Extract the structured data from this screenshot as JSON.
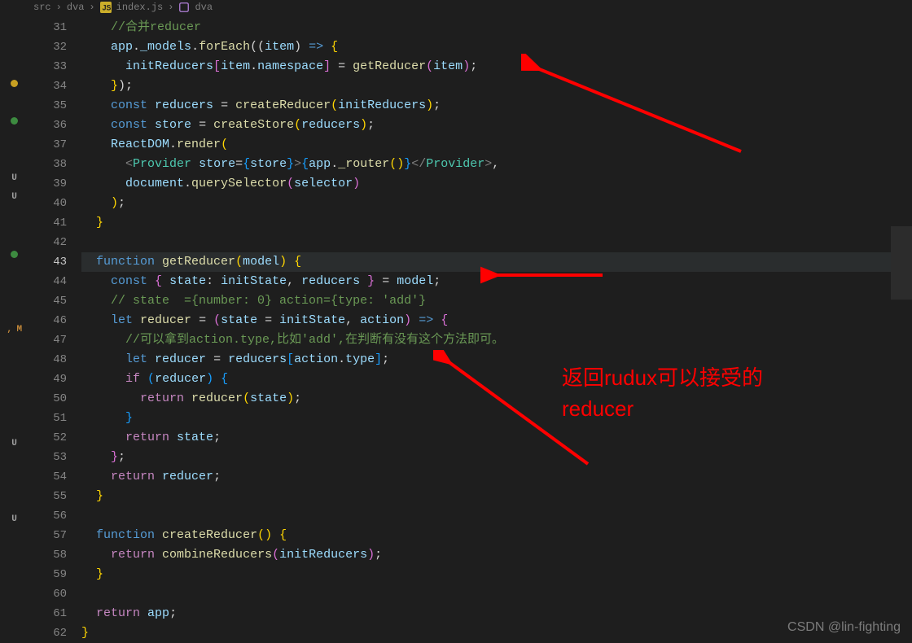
{
  "breadcrumb": {
    "folder": "src",
    "sub": "dva",
    "file": "index.js",
    "symbol": "dva"
  },
  "gutter": [
    "",
    "",
    "dot-yellow",
    "",
    "dot-green",
    "",
    "",
    "U",
    "U",
    "",
    "",
    "dot-green",
    "",
    "",
    "",
    ", M",
    "",
    "",
    "",
    "",
    "",
    "U",
    "",
    "",
    "",
    "U",
    "",
    "",
    "",
    "",
    "",
    ""
  ],
  "lineStart": 31,
  "activeLine": 43,
  "code": [
    [
      [
        "g",
        "    "
      ],
      [
        "c-comment",
        "//合并reducer"
      ]
    ],
    [
      [
        "g",
        "    "
      ],
      [
        "c-var",
        "app"
      ],
      [
        "c-punct",
        "."
      ],
      [
        "c-var",
        "_models"
      ],
      [
        "c-punct",
        "."
      ],
      [
        "c-func",
        "forEach"
      ],
      [
        "c-punct",
        "(("
      ],
      [
        "c-var",
        "item"
      ],
      [
        "c-punct",
        ") "
      ],
      [
        "c-key",
        "=>"
      ],
      [
        "c-punct",
        " "
      ],
      [
        "c-brace-y",
        "{"
      ]
    ],
    [
      [
        "g",
        "      "
      ],
      [
        "c-var",
        "initReducers"
      ],
      [
        "c-brace-p",
        "["
      ],
      [
        "c-var",
        "item"
      ],
      [
        "c-punct",
        "."
      ],
      [
        "c-var",
        "namespace"
      ],
      [
        "c-brace-p",
        "]"
      ],
      [
        "c-punct",
        " = "
      ],
      [
        "c-func",
        "getReducer"
      ],
      [
        "c-brace-p",
        "("
      ],
      [
        "c-var",
        "item"
      ],
      [
        "c-brace-p",
        ")"
      ],
      [
        "c-punct",
        ";"
      ]
    ],
    [
      [
        "g",
        "    "
      ],
      [
        "c-brace-y",
        "}"
      ],
      [
        "c-punct",
        ");"
      ]
    ],
    [
      [
        "g",
        "    "
      ],
      [
        "c-key",
        "const"
      ],
      [
        "c-punct",
        " "
      ],
      [
        "c-var",
        "reducers"
      ],
      [
        "c-punct",
        " = "
      ],
      [
        "c-func",
        "createReducer"
      ],
      [
        "c-brace-y",
        "("
      ],
      [
        "c-var",
        "initReducers"
      ],
      [
        "c-brace-y",
        ")"
      ],
      [
        "c-punct",
        ";"
      ]
    ],
    [
      [
        "g",
        "    "
      ],
      [
        "c-key",
        "const"
      ],
      [
        "c-punct",
        " "
      ],
      [
        "c-var",
        "store"
      ],
      [
        "c-punct",
        " = "
      ],
      [
        "c-func",
        "createStore"
      ],
      [
        "c-brace-y",
        "("
      ],
      [
        "c-var",
        "reducers"
      ],
      [
        "c-brace-y",
        ")"
      ],
      [
        "c-punct",
        ";"
      ]
    ],
    [
      [
        "g",
        "    "
      ],
      [
        "c-var",
        "ReactDOM"
      ],
      [
        "c-punct",
        "."
      ],
      [
        "c-func",
        "render"
      ],
      [
        "c-brace-y",
        "("
      ]
    ],
    [
      [
        "g",
        "      "
      ],
      [
        "c-tagpunc",
        "<"
      ],
      [
        "c-tag",
        "Provider"
      ],
      [
        "c-punct",
        " "
      ],
      [
        "c-var",
        "store"
      ],
      [
        "c-punct",
        "="
      ],
      [
        "c-brace-b",
        "{"
      ],
      [
        "c-var",
        "store"
      ],
      [
        "c-brace-b",
        "}"
      ],
      [
        "c-tagpunc",
        ">"
      ],
      [
        "c-brace-b",
        "{"
      ],
      [
        "c-var",
        "app"
      ],
      [
        "c-punct",
        "."
      ],
      [
        "c-func",
        "_router"
      ],
      [
        "c-brace-y",
        "()"
      ],
      [
        "c-brace-b",
        "}"
      ],
      [
        "c-tagpunc",
        "</"
      ],
      [
        "c-tag",
        "Provider"
      ],
      [
        "c-tagpunc",
        ">"
      ],
      [
        "c-punct",
        ","
      ]
    ],
    [
      [
        "g",
        "      "
      ],
      [
        "c-var",
        "document"
      ],
      [
        "c-punct",
        "."
      ],
      [
        "c-func",
        "querySelector"
      ],
      [
        "c-brace-p",
        "("
      ],
      [
        "c-var",
        "selector"
      ],
      [
        "c-brace-p",
        ")"
      ]
    ],
    [
      [
        "g",
        "    "
      ],
      [
        "c-brace-y",
        ")"
      ],
      [
        "c-punct",
        ";"
      ]
    ],
    [
      [
        "g",
        "  "
      ],
      [
        "c-brace-y",
        "}"
      ]
    ],
    [
      [
        "g",
        ""
      ]
    ],
    [
      [
        "g",
        "  "
      ],
      [
        "c-key",
        "function"
      ],
      [
        "c-punct",
        " "
      ],
      [
        "c-func",
        "getReducer"
      ],
      [
        "c-brace-y",
        "("
      ],
      [
        "c-var",
        "model"
      ],
      [
        "c-brace-y",
        ") {"
      ]
    ],
    [
      [
        "g",
        "    "
      ],
      [
        "c-key",
        "const"
      ],
      [
        "c-punct",
        " "
      ],
      [
        "c-brace-p",
        "{"
      ],
      [
        "c-punct",
        " "
      ],
      [
        "c-var",
        "state"
      ],
      [
        "c-punct",
        ": "
      ],
      [
        "c-var",
        "initState"
      ],
      [
        "c-punct",
        ", "
      ],
      [
        "c-var",
        "reducers"
      ],
      [
        "c-punct",
        " "
      ],
      [
        "c-brace-p",
        "}"
      ],
      [
        "c-punct",
        " = "
      ],
      [
        "c-var",
        "model"
      ],
      [
        "c-punct",
        ";"
      ]
    ],
    [
      [
        "g",
        "    "
      ],
      [
        "c-comment",
        "// state  ={number: 0} action={type: 'add'}"
      ]
    ],
    [
      [
        "g",
        "    "
      ],
      [
        "c-key",
        "let"
      ],
      [
        "c-punct",
        " "
      ],
      [
        "c-func",
        "reducer"
      ],
      [
        "c-punct",
        " = "
      ],
      [
        "c-brace-p",
        "("
      ],
      [
        "c-var",
        "state"
      ],
      [
        "c-punct",
        " = "
      ],
      [
        "c-var",
        "initState"
      ],
      [
        "c-punct",
        ", "
      ],
      [
        "c-var",
        "action"
      ],
      [
        "c-brace-p",
        ")"
      ],
      [
        "c-punct",
        " "
      ],
      [
        "c-key",
        "=>"
      ],
      [
        "c-punct",
        " "
      ],
      [
        "c-brace-p",
        "{"
      ]
    ],
    [
      [
        "g",
        "      "
      ],
      [
        "c-comment",
        "//可以拿到action.type,比如'add',在判断有没有这个方法即可。"
      ]
    ],
    [
      [
        "g",
        "      "
      ],
      [
        "c-key",
        "let"
      ],
      [
        "c-punct",
        " "
      ],
      [
        "c-var",
        "reducer"
      ],
      [
        "c-punct",
        " = "
      ],
      [
        "c-var",
        "reducers"
      ],
      [
        "c-brace-b",
        "["
      ],
      [
        "c-var",
        "action"
      ],
      [
        "c-punct",
        "."
      ],
      [
        "c-var",
        "type"
      ],
      [
        "c-brace-b",
        "]"
      ],
      [
        "c-punct",
        ";"
      ]
    ],
    [
      [
        "g",
        "      "
      ],
      [
        "c-key2",
        "if"
      ],
      [
        "c-punct",
        " "
      ],
      [
        "c-brace-b",
        "("
      ],
      [
        "c-var",
        "reducer"
      ],
      [
        "c-brace-b",
        ")"
      ],
      [
        "c-punct",
        " "
      ],
      [
        "c-brace-b",
        "{"
      ]
    ],
    [
      [
        "g",
        "        "
      ],
      [
        "c-key2",
        "return"
      ],
      [
        "c-punct",
        " "
      ],
      [
        "c-func",
        "reducer"
      ],
      [
        "c-brace-y",
        "("
      ],
      [
        "c-var",
        "state"
      ],
      [
        "c-brace-y",
        ")"
      ],
      [
        "c-punct",
        ";"
      ]
    ],
    [
      [
        "g",
        "      "
      ],
      [
        "c-brace-b",
        "}"
      ]
    ],
    [
      [
        "g",
        "      "
      ],
      [
        "c-key2",
        "return"
      ],
      [
        "c-punct",
        " "
      ],
      [
        "c-var",
        "state"
      ],
      [
        "c-punct",
        ";"
      ]
    ],
    [
      [
        "g",
        "    "
      ],
      [
        "c-brace-p",
        "}"
      ],
      [
        "c-punct",
        ";"
      ]
    ],
    [
      [
        "g",
        "    "
      ],
      [
        "c-key2",
        "return"
      ],
      [
        "c-punct",
        " "
      ],
      [
        "c-var",
        "reducer"
      ],
      [
        "c-punct",
        ";"
      ]
    ],
    [
      [
        "g",
        "  "
      ],
      [
        "c-brace-y",
        "}"
      ]
    ],
    [
      [
        "g",
        ""
      ]
    ],
    [
      [
        "g",
        "  "
      ],
      [
        "c-key",
        "function"
      ],
      [
        "c-punct",
        " "
      ],
      [
        "c-func",
        "createReducer"
      ],
      [
        "c-brace-y",
        "() {"
      ]
    ],
    [
      [
        "g",
        "    "
      ],
      [
        "c-key2",
        "return"
      ],
      [
        "c-punct",
        " "
      ],
      [
        "c-func",
        "combineReducers"
      ],
      [
        "c-brace-p",
        "("
      ],
      [
        "c-var",
        "initReducers"
      ],
      [
        "c-brace-p",
        ")"
      ],
      [
        "c-punct",
        ";"
      ]
    ],
    [
      [
        "g",
        "  "
      ],
      [
        "c-brace-y",
        "}"
      ]
    ],
    [
      [
        "g",
        ""
      ]
    ],
    [
      [
        "g",
        "  "
      ],
      [
        "c-key2",
        "return"
      ],
      [
        "c-punct",
        " "
      ],
      [
        "c-var",
        "app"
      ],
      [
        "c-punct",
        ";"
      ]
    ],
    [
      [
        "g",
        ""
      ],
      [
        "c-brace-y",
        "}"
      ]
    ]
  ],
  "annotation": {
    "line1": "返回rudux可以接受的",
    "line2": "reducer"
  },
  "watermark": "CSDN @lin-fighting"
}
